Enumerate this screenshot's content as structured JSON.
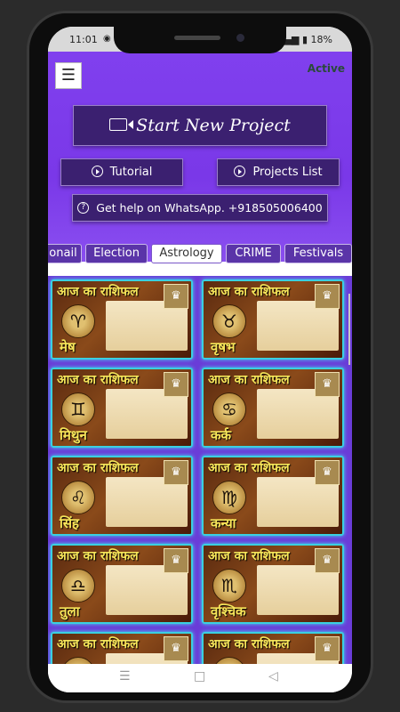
{
  "status": {
    "time": "11:01",
    "battery": "18%"
  },
  "header": {
    "menu_icon": "hamburger-icon",
    "active_label": "Active",
    "start_label": "Start New Project",
    "tutorial_label": "Tutorial",
    "projects_label": "Projects List",
    "help_label": "Get help on WhatsApp. +918505006400"
  },
  "tabs": [
    "onail",
    "Election",
    "Astrology",
    "CRIME",
    "Festivals"
  ],
  "selected_tab": "Astrology",
  "cards": [
    {
      "title": "आज का राशिफल",
      "sign": "मेष",
      "glyph": "♈"
    },
    {
      "title": "आज का राशिफल",
      "sign": "वृषभ",
      "glyph": "♉"
    },
    {
      "title": "आज का राशिफल",
      "sign": "मिथुन",
      "glyph": "♊"
    },
    {
      "title": "आज का राशिफल",
      "sign": "कर्क",
      "glyph": "♋"
    },
    {
      "title": "आज का राशिफल",
      "sign": "सिंह",
      "glyph": "♌"
    },
    {
      "title": "आज का राशिफल",
      "sign": "कन्या",
      "glyph": "♍"
    },
    {
      "title": "आज का राशिफल",
      "sign": "तुला",
      "glyph": "♎"
    },
    {
      "title": "आज का राशिफल",
      "sign": "वृश्चिक",
      "glyph": "♏"
    },
    {
      "title": "आज का राशिफल",
      "sign": "",
      "glyph": "♐"
    },
    {
      "title": "आज का राशिफल",
      "sign": "",
      "glyph": "♑"
    }
  ],
  "colors": {
    "accent": "#7a38e8",
    "card_border": "#3ad0e0",
    "title_yellow": "#f7e65a"
  }
}
